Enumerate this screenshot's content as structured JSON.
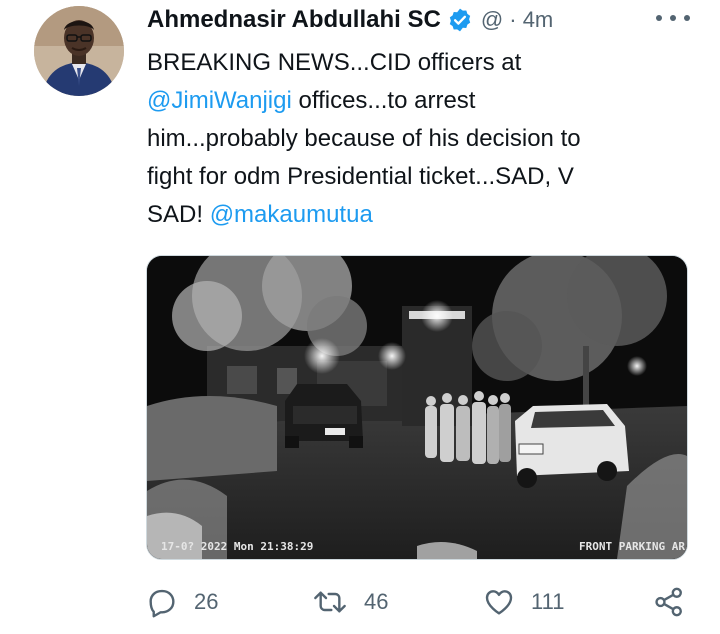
{
  "tweet": {
    "author_name": "Ahmednasir Abdullahi SC",
    "handle_time": "@ · 4m",
    "text_lines": [
      [
        {
          "t": "BREAKING NEWS...CID officers at",
          "m": false
        }
      ],
      [
        {
          "t": "@JimiWanjigi",
          "m": true
        },
        {
          "t": " offices...to arrest",
          "m": false
        }
      ],
      [
        {
          "t": "him...probably because of his decision to",
          "m": false
        }
      ],
      [
        {
          "t": "fight for odm Presidential ticket...SAD, V",
          "m": false
        }
      ],
      [
        {
          "t": "SAD! ",
          "m": false
        },
        {
          "t": "@makaumutua",
          "m": true
        }
      ]
    ]
  },
  "media": {
    "timestamp": "17-0? 2022 Mon 21:38:29",
    "camera_label": "FRONT PARKING AR"
  },
  "actions": {
    "reply_count": "26",
    "retweet_count": "46",
    "like_count": "111"
  },
  "colors": {
    "link": "#1d9bf0",
    "verified": "#1d9bf0",
    "muted": "#536471"
  }
}
